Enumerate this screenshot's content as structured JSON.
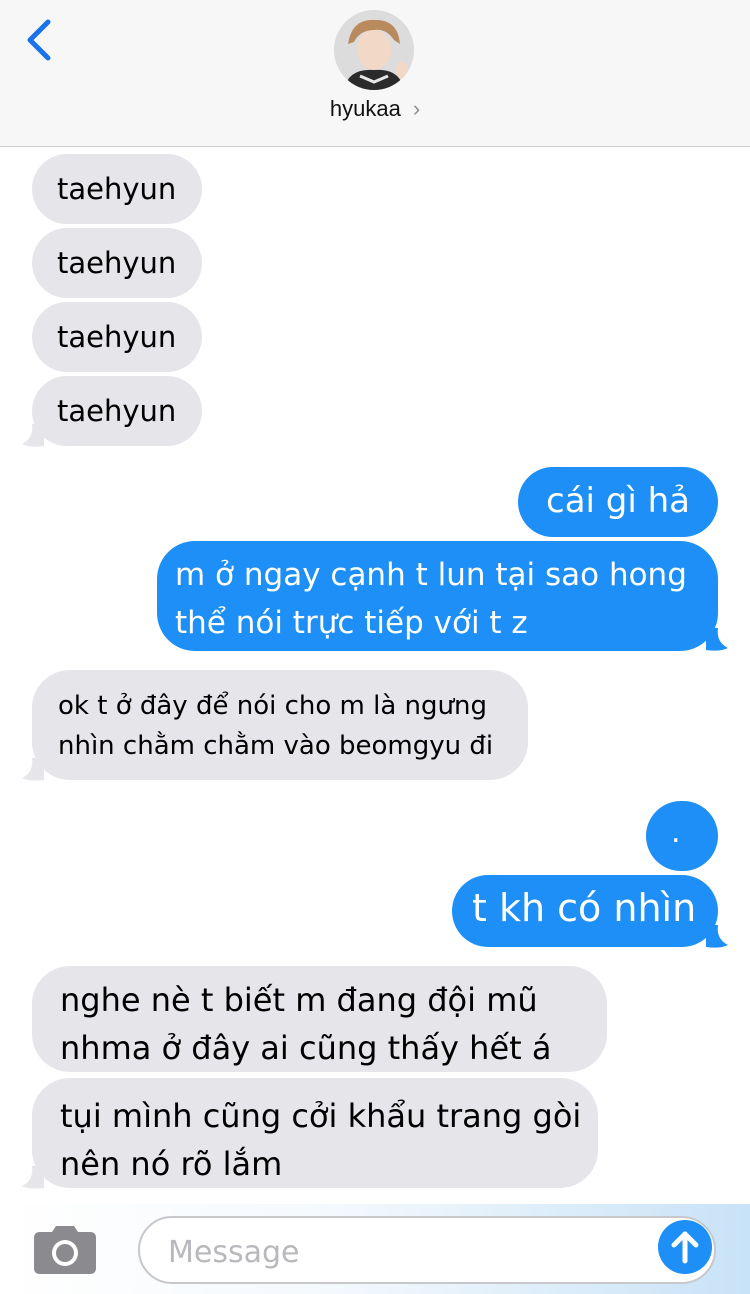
{
  "header": {
    "contact_name": "hyukaa",
    "chevron": "›"
  },
  "messages": [
    {
      "id": "m1",
      "side": "received",
      "lines": [
        "taehyun"
      ]
    },
    {
      "id": "m2",
      "side": "received",
      "lines": [
        "taehyun"
      ]
    },
    {
      "id": "m3",
      "side": "received",
      "lines": [
        "taehyun"
      ]
    },
    {
      "id": "m4",
      "side": "received",
      "lines": [
        "taehyun"
      ]
    },
    {
      "id": "m5",
      "side": "sent",
      "lines": [
        "cái gì hả"
      ]
    },
    {
      "id": "m6",
      "side": "sent",
      "lines": [
        "m ở ngay cạnh t lun tại sao hong",
        "thể nói trực tiếp với t z"
      ]
    },
    {
      "id": "m7",
      "side": "received",
      "lines": [
        "ok t ở đây để nói cho m là ngưng",
        "nhìn chằm chằm vào beomgyu đi"
      ]
    },
    {
      "id": "m8",
      "side": "sent",
      "lines": [
        "."
      ]
    },
    {
      "id": "m9",
      "side": "sent",
      "lines": [
        "t kh có nhìn"
      ]
    },
    {
      "id": "m10",
      "side": "received",
      "lines": [
        "nghe nè t biết m đang đội mũ",
        "nhma ở đây ai cũng thấy hết á"
      ]
    },
    {
      "id": "m11",
      "side": "received",
      "lines": [
        "tụi mình cũng cởi khẩu trang gòi",
        "nên nó rõ lắm"
      ]
    }
  ],
  "composer": {
    "placeholder": "Message"
  },
  "icons": {
    "back": "back-chevron-icon",
    "camera": "camera-icon",
    "send": "send-arrow-icon"
  },
  "colors": {
    "sent_bubble": "#1d8ff7",
    "received_bubble": "#e5e5ea",
    "accent": "#1a73e8"
  }
}
